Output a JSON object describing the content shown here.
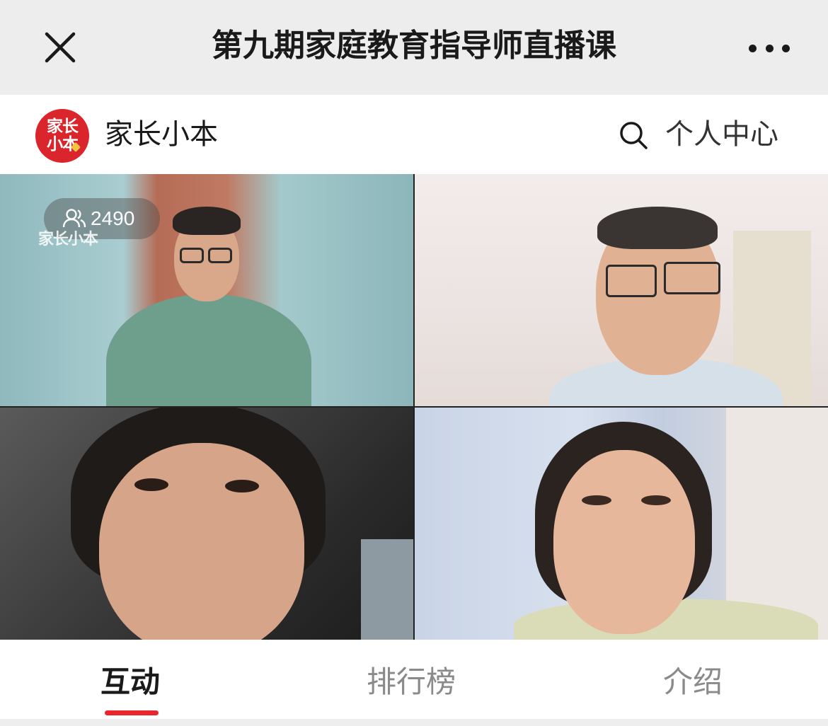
{
  "navbar": {
    "title": "第九期家庭教育指导师直播课",
    "close_icon": "close-icon",
    "more_icon": "more-horizontal-icon"
  },
  "brand": {
    "logo_line1": "家长",
    "logo_line2": "小本",
    "name": "家长小本",
    "search_icon": "search-icon",
    "personal_center": "个人中心"
  },
  "live": {
    "viewer_icon": "people-icon",
    "viewer_count": "2490",
    "watermark": "家长小本"
  },
  "tabs": {
    "items": [
      "互动",
      "排行榜",
      "介绍"
    ],
    "active": "互动"
  },
  "colors": {
    "accent": "#e8262b",
    "brand_red": "#d9252b",
    "navbar_bg": "#ededed"
  }
}
